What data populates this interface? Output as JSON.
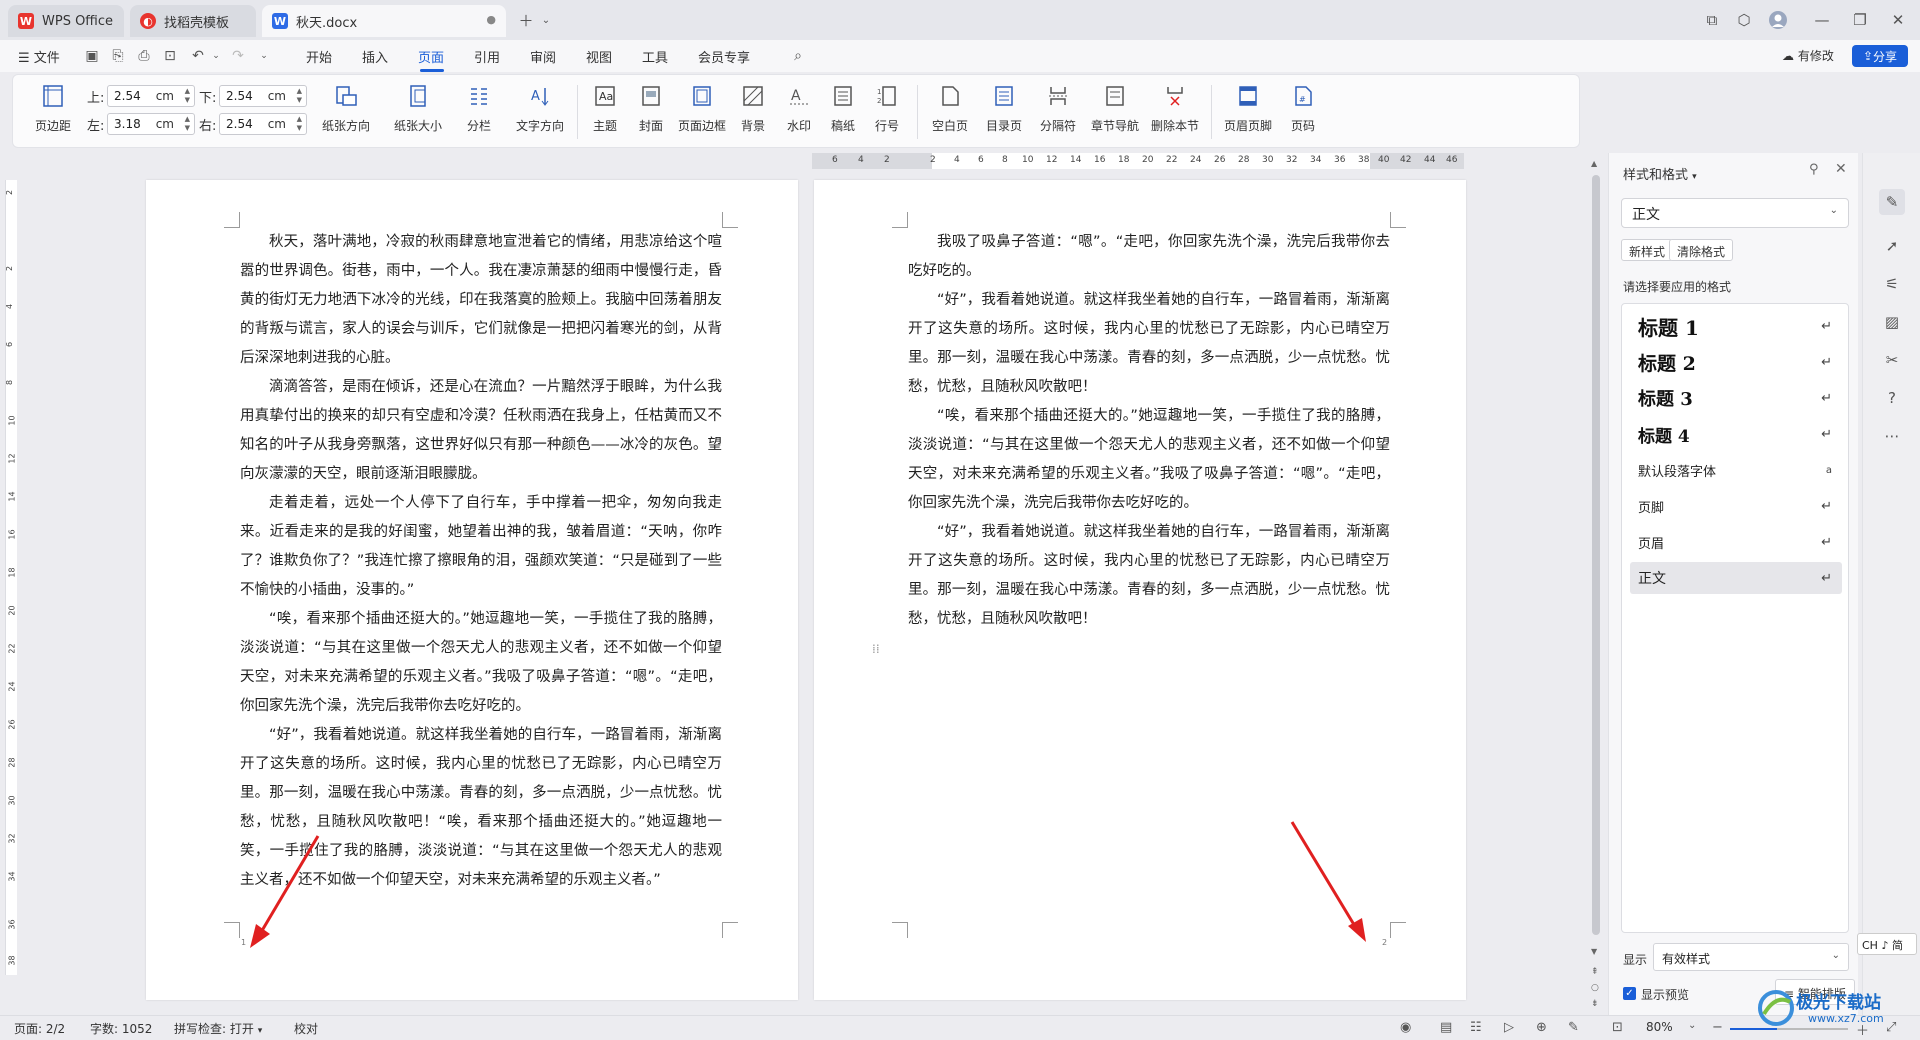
{
  "tabs": [
    {
      "label": "WPS Office",
      "icon": "wps-logo-icon"
    },
    {
      "label": "找稻壳模板",
      "icon": "docer-icon"
    },
    {
      "label": "秋天.docx",
      "icon": "word-doc-icon"
    }
  ],
  "menu": {
    "file": "文件",
    "items": [
      "开始",
      "插入",
      "页面",
      "引用",
      "审阅",
      "视图",
      "工具",
      "会员专享"
    ],
    "active": "页面",
    "has_changes": "有修改",
    "share": "分享"
  },
  "ribbon": {
    "margins_btn": "页边距",
    "top_label": "上:",
    "top_value": "2.54",
    "unit": "cm",
    "bottom_label": "下:",
    "bottom_value": "2.54",
    "left_label": "左:",
    "left_value": "3.18",
    "right_label": "右:",
    "right_value": "2.54",
    "orientation": "纸张方向",
    "size": "纸张大小",
    "columns": "分栏",
    "text_direction": "文字方向",
    "theme": "主题",
    "cover": "封面",
    "page_border": "页面边框",
    "background": "背景",
    "watermark": "水印",
    "manuscript": "稿纸",
    "line_number": "行号",
    "blank_page": "空白页",
    "toc_page": "目录页",
    "separator": "分隔符",
    "section_nav": "章节导航",
    "delete_section": "删除本节",
    "header_footer": "页眉页脚",
    "page_number": "页码"
  },
  "ruler": {
    "h_ticks": [
      "6",
      "4",
      "2",
      "2",
      "4",
      "6",
      "8",
      "10",
      "12",
      "14",
      "16",
      "18",
      "20",
      "22",
      "24",
      "26",
      "28",
      "30",
      "32",
      "34",
      "36",
      "38",
      "40",
      "42",
      "44",
      "46"
    ],
    "v_ticks": [
      "2",
      "2",
      "4",
      "6",
      "8",
      "10",
      "12",
      "14",
      "16",
      "18",
      "20",
      "22",
      "24",
      "26",
      "28",
      "30",
      "32",
      "34",
      "36",
      "38"
    ]
  },
  "page1": {
    "paragraphs": [
      "秋天，落叶满地，冷寂的秋雨肆意地宣泄着它的情绪，用悲凉给这个喧嚣的世界调色。街巷，雨中，一个人。我在凄凉萧瑟的细雨中慢慢行走，昏黄的街灯无力地洒下冰冷的光线，印在我落寞的脸颊上。我脑中回荡着朋友的背叛与谎言，家人的误会与训斥，它们就像是一把把闪着寒光的剑，从背后深深地刺进我的心脏。",
      "滴滴答答，是雨在倾诉，还是心在流血？一片黯然浮于眼眸，为什么我用真挚付出的换来的却只有空虚和冷漠？任秋雨洒在我身上，任枯黄而又不知名的叶子从我身旁飘落，这世界好似只有那一种颜色——冰冷的灰色。望向灰濛濛的天空，眼前逐渐泪眼朦胧。",
      "走着走着，远处一个人停下了自行车，手中撑着一把伞，匆匆向我走来。近看走来的是我的好闺蜜，她望着出神的我，皱着眉道：“天呐，你咋了？谁欺负你了？”我连忙擦了擦眼角的泪，强颜欢笑道：“只是碰到了一些不愉快的小插曲，没事的。”",
      "“唉，看来那个插曲还挺大的。”她逗趣地一笑，一手揽住了我的胳膊，淡淡说道：“与其在这里做一个怨天尤人的悲观主义者，还不如做一个仰望天空，对未来充满希望的乐观主义者。”我吸了吸鼻子答道：“嗯”。“走吧，你回家先洗个澡，洗完后我带你去吃好吃的。",
      "“好”，我看着她说道。就这样我坐着她的自行车，一路冒着雨，渐渐离开了这失意的场所。这时候，我内心里的忧愁已了无踪影，内心已晴空万里。那一刻，温暖在我心中荡漾。青春的刻，多一点洒脱，少一点忧愁。忧愁，忧愁，且随秋风吹散吧！“唉，看来那个插曲还挺大的。”她逗趣地一笑，一手揽住了我的胳膊，淡淡说道：“与其在这里做一个怨天尤人的悲观主义者，还不如做一个仰望天空，对未来充满希望的乐观主义者。”"
    ],
    "page_number": "1"
  },
  "page2": {
    "paragraphs": [
      "我吸了吸鼻子答道：“嗯”。“走吧，你回家先洗个澡，洗完后我带你去吃好吃的。",
      "“好”，我看着她说道。就这样我坐着她的自行车，一路冒着雨，渐渐离开了这失意的场所。这时候，我内心里的忧愁已了无踪影，内心已晴空万里。那一刻，温暖在我心中荡漾。青春的刻，多一点洒脱，少一点忧愁。忧愁，忧愁，且随秋风吹散吧！",
      "“唉，看来那个插曲还挺大的。”她逗趣地一笑，一手揽住了我的胳膊，淡淡说道：“与其在这里做一个怨天尤人的悲观主义者，还不如做一个仰望天空，对未来充满希望的乐观主义者。”我吸了吸鼻子答道：“嗯”。“走吧，你回家先洗个澡，洗完后我带你去吃好吃的。",
      "“好”，我看着她说道。就这样我坐着她的自行车，一路冒着雨，渐渐离开了这失意的场所。这时候，我内心里的忧愁已了无踪影，内心已晴空万里。那一刻，温暖在我心中荡漾。青春的刻，多一点洒脱，少一点忧愁。忧愁，忧愁，且随秋风吹散吧！"
    ],
    "page_number": "2"
  },
  "panel": {
    "title": "样式和格式",
    "current_style": "正文",
    "new_style": "新样式",
    "clear_format": "清除格式",
    "apply_hint": "请选择要应用的格式",
    "styles": [
      {
        "label": "标题  1",
        "kind": "heading"
      },
      {
        "label": "标题  2",
        "kind": "heading"
      },
      {
        "label": "标题  3",
        "kind": "heading"
      },
      {
        "label": "标题  4",
        "kind": "heading"
      },
      {
        "label": "默认段落字体",
        "kind": "normal"
      },
      {
        "label": "页脚",
        "kind": "normal"
      },
      {
        "label": "页眉",
        "kind": "normal"
      },
      {
        "label": "正文",
        "kind": "normal"
      }
    ],
    "selected": "正文",
    "show_label": "显示",
    "show_value": "有效样式",
    "preview_label": "显示预览",
    "smart_layout": "智能排版",
    "ime": "CH ♪ 简"
  },
  "status": {
    "page": "页面: 2/2",
    "words": "字数: 1052",
    "spell": "拼写检查: 打开",
    "proof": "校对",
    "zoom": "80%"
  },
  "watermark_text": "极光下载站",
  "watermark_url": "www.xz7.com",
  "colors": {
    "accent": "#1a5ed8",
    "arrow": "#e02020",
    "wps_red": "#e8342e"
  }
}
